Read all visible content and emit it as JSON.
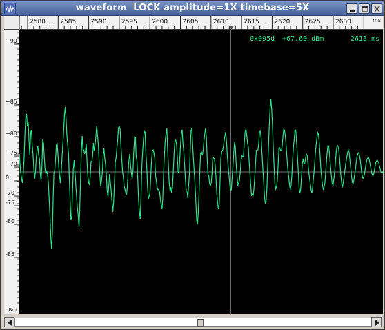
{
  "window": {
    "title": "waveform  LOCK amplitude=1X timebase=5X",
    "buttons": {
      "minimize": "minimize",
      "maximize": "maximize",
      "close": "close"
    }
  },
  "time_ruler": {
    "tick_labels": [
      "2580",
      "2585",
      "2590",
      "2595",
      "2600",
      "2605",
      "2610",
      "2615",
      "2620",
      "2625",
      "2630"
    ],
    "unit": "ms"
  },
  "amplitude_ruler": {
    "labels": [
      "+90",
      "+85",
      "+80",
      "+75",
      "+70",
      "0",
      "-70",
      "-75",
      "-80",
      "-85"
    ],
    "unit": "dBm"
  },
  "readout": {
    "address": "0x095d",
    "value": "+67.60 dBm",
    "time": "2613 ms"
  },
  "colors": {
    "trace": "#2ee58a",
    "plot_background": "#000000",
    "crosshair": "#7a7a7a",
    "titlebar": "#5a75ac"
  },
  "waveform": {
    "amplitude_scale": "1X",
    "timebase": "5X",
    "cursor_time_ms": 2613,
    "samples": [
      232,
      214,
      203,
      195,
      190,
      205,
      228,
      262,
      284,
      290,
      272,
      278,
      252,
      230,
      262,
      267,
      245,
      231,
      212,
      196,
      206,
      225,
      238,
      243,
      231,
      225,
      203,
      194,
      212,
      253,
      248,
      227,
      209,
      203,
      207,
      203,
      190,
      168,
      144,
      112,
      95,
      116,
      170,
      205,
      208,
      226,
      246,
      247,
      230,
      212,
      200,
      190,
      207,
      227,
      246,
      266,
      288,
      300,
      283,
      260,
      245,
      232,
      199,
      166,
      137,
      140,
      177,
      210,
      223,
      208,
      188,
      171,
      154,
      144,
      126,
      151,
      196,
      238,
      258,
      238,
      238,
      232,
      236,
      247,
      220,
      200,
      190,
      188,
      200,
      221,
      221,
      230,
      248,
      236,
      245,
      258,
      273,
      259,
      246,
      221,
      199,
      185,
      194,
      206,
      229,
      240,
      225,
      217,
      200,
      178,
      170,
      186,
      203,
      191,
      178,
      162,
      148,
      162,
      190,
      220,
      226,
      240,
      253,
      270,
      272,
      268,
      246,
      226,
      207,
      199,
      186,
      181,
      176,
      172,
      185,
      206,
      223,
      232,
      215,
      205,
      196,
      208,
      236,
      257,
      256,
      228,
      221,
      193,
      165,
      148,
      138,
      169,
      214,
      236,
      254,
      265,
      264,
      232,
      215,
      185,
      167,
      170,
      175,
      198,
      222,
      236,
      238,
      234,
      226,
      200,
      193,
      183,
      180,
      180,
      177,
      166,
      158,
      152,
      169,
      206,
      231,
      252,
      262,
      269,
      238,
      212,
      189,
      178,
      184,
      176,
      183,
      208,
      235,
      250,
      252,
      246,
      228,
      206,
      204,
      224,
      246,
      262,
      267,
      247,
      235,
      217,
      195,
      179,
      178,
      168,
      187,
      204,
      237,
      265,
      270,
      246,
      224,
      205,
      187,
      162,
      136,
      130,
      147,
      178,
      211,
      234,
      235,
      230,
      237,
      251,
      261,
      269,
      257,
      225,
      203,
      200,
      189,
      186,
      190,
      204,
      227,
      226,
      225,
      216,
      196,
      174,
      160,
      152,
      160,
      194,
      226,
      235,
      237,
      241,
      251,
      258,
      264,
      250,
      229,
      215,
      202,
      188,
      180,
      180,
      199,
      216,
      235,
      250,
      241,
      218,
      200,
      186,
      190,
      193,
      205,
      221,
      230,
      228,
      228,
      247,
      263,
      268,
      261,
      248,
      242,
      223,
      205,
      186,
      172,
      174,
      171,
      181,
      198,
      219,
      237,
      238,
      238,
      248,
      264,
      265,
      254,
      233,
      212,
      193,
      172,
      161,
      162,
      179,
      211,
      242,
      271,
      297,
      311,
      298,
      275,
      240,
      213,
      189,
      181,
      184,
      193,
      216,
      241,
      241,
      237,
      237,
      243,
      258,
      268,
      266,
      258,
      243,
      226,
      210,
      200,
      188,
      180,
      186,
      201,
      224,
      242,
      254,
      268,
      265,
      247,
      228,
      207,
      183,
      175,
      181,
      200,
      218,
      225,
      218,
      218,
      226,
      232,
      230,
      219,
      206,
      196,
      188,
      179,
      175,
      186,
      199,
      212,
      230,
      244,
      254,
      263,
      261,
      248,
      230,
      211,
      197,
      187,
      180,
      184,
      190,
      205,
      222,
      237,
      245,
      241,
      228,
      214,
      201,
      190,
      186,
      194,
      204,
      219,
      234,
      243,
      244,
      240,
      229,
      213,
      199,
      188,
      185,
      192,
      201,
      210,
      219,
      226,
      233,
      238,
      235,
      224,
      212,
      200,
      191,
      189,
      194,
      203,
      211,
      221,
      229,
      233,
      234,
      230,
      222,
      211,
      202,
      197,
      197,
      202,
      210,
      217,
      223,
      226,
      227,
      224,
      218,
      211,
      205,
      201,
      201,
      205,
      212,
      219,
      222,
      223,
      221,
      218,
      213,
      208,
      205,
      204,
      207
    ]
  }
}
